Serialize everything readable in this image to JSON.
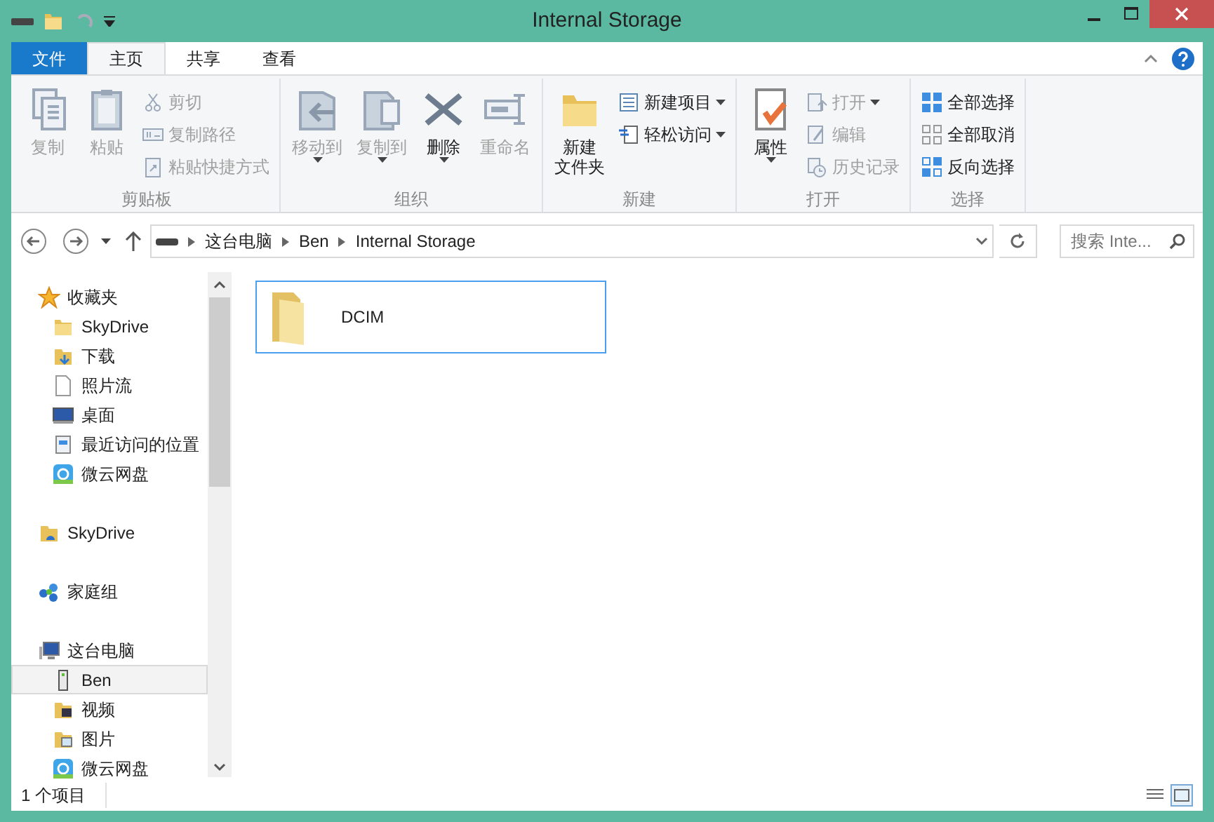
{
  "window": {
    "title": "Internal Storage"
  },
  "ribbon_tabs": [
    {
      "label": "文件",
      "kind": "file",
      "selected": false
    },
    {
      "label": "主页",
      "kind": "tab",
      "selected": true
    },
    {
      "label": "共享",
      "kind": "tab",
      "selected": false
    },
    {
      "label": "查看",
      "kind": "tab",
      "selected": false
    }
  ],
  "ribbon_groups": [
    {
      "label": "剪贴板",
      "commands": [
        {
          "label": "复制",
          "kind": "large",
          "disabled": true,
          "has_menu": false
        },
        {
          "label": "粘贴",
          "kind": "large",
          "disabled": true,
          "has_menu": false
        },
        {
          "label": "剪切",
          "kind": "small",
          "disabled": true,
          "has_menu": false
        },
        {
          "label": "复制路径",
          "kind": "small",
          "disabled": true,
          "has_menu": false
        },
        {
          "label": "粘贴快捷方式",
          "kind": "small",
          "disabled": true,
          "has_menu": false
        }
      ]
    },
    {
      "label": "组织",
      "commands": [
        {
          "label": "移动到",
          "kind": "large",
          "disabled": true,
          "has_menu": true
        },
        {
          "label": "复制到",
          "kind": "large",
          "disabled": true,
          "has_menu": true
        },
        {
          "label": "删除",
          "kind": "large",
          "disabled": false,
          "has_menu": true
        },
        {
          "label": "重命名",
          "kind": "large",
          "disabled": true,
          "has_menu": false
        }
      ]
    },
    {
      "label": "新建",
      "commands": [
        {
          "label_lines": [
            "新建",
            "文件夹"
          ],
          "kind": "large",
          "disabled": false,
          "has_menu": false
        },
        {
          "label": "新建项目",
          "kind": "small",
          "disabled": false,
          "has_menu": true
        },
        {
          "label": "轻松访问",
          "kind": "small",
          "disabled": false,
          "has_menu": true
        }
      ]
    },
    {
      "label": "打开",
      "commands": [
        {
          "label": "属性",
          "kind": "large",
          "disabled": false,
          "has_menu": true
        },
        {
          "label": "打开",
          "kind": "small",
          "disabled": true,
          "has_menu": true
        },
        {
          "label": "编辑",
          "kind": "small",
          "disabled": true,
          "has_menu": false
        },
        {
          "label": "历史记录",
          "kind": "small",
          "disabled": true,
          "has_menu": false
        }
      ]
    },
    {
      "label": "选择",
      "commands": [
        {
          "label": "全部选择",
          "kind": "small",
          "disabled": false,
          "has_menu": false
        },
        {
          "label": "全部取消",
          "kind": "small",
          "disabled": false,
          "has_menu": false
        },
        {
          "label": "反向选择",
          "kind": "small",
          "disabled": false,
          "has_menu": false
        }
      ]
    }
  ],
  "address_bar": {
    "breadcrumbs": [
      "这台电脑",
      "Ben",
      "Internal Storage"
    ]
  },
  "search": {
    "placeholder": "搜索 Inte..."
  },
  "navigation": [
    {
      "label": "收藏夹",
      "selected": false,
      "children": [
        {
          "label": "SkyDrive",
          "selected": false
        },
        {
          "label": "下载",
          "selected": false
        },
        {
          "label": "照片流",
          "selected": false
        },
        {
          "label": "桌面",
          "selected": false
        },
        {
          "label": "最近访问的位置",
          "selected": false
        },
        {
          "label": "微云网盘",
          "selected": false
        }
      ]
    },
    {
      "label": "SkyDrive",
      "selected": false
    },
    {
      "label": "家庭组",
      "selected": false
    },
    {
      "label": "这台电脑",
      "selected": false,
      "children": [
        {
          "label": "Ben",
          "selected": true
        },
        {
          "label": "视频",
          "selected": false
        },
        {
          "label": "图片",
          "selected": false
        },
        {
          "label": "微云网盘",
          "selected": false
        }
      ]
    }
  ],
  "files": [
    {
      "name": "DCIM",
      "selected": true
    }
  ],
  "status_bar": {
    "item_count": "1 个项目",
    "view_modes": [
      {
        "selected": false
      },
      {
        "selected": true
      }
    ]
  }
}
